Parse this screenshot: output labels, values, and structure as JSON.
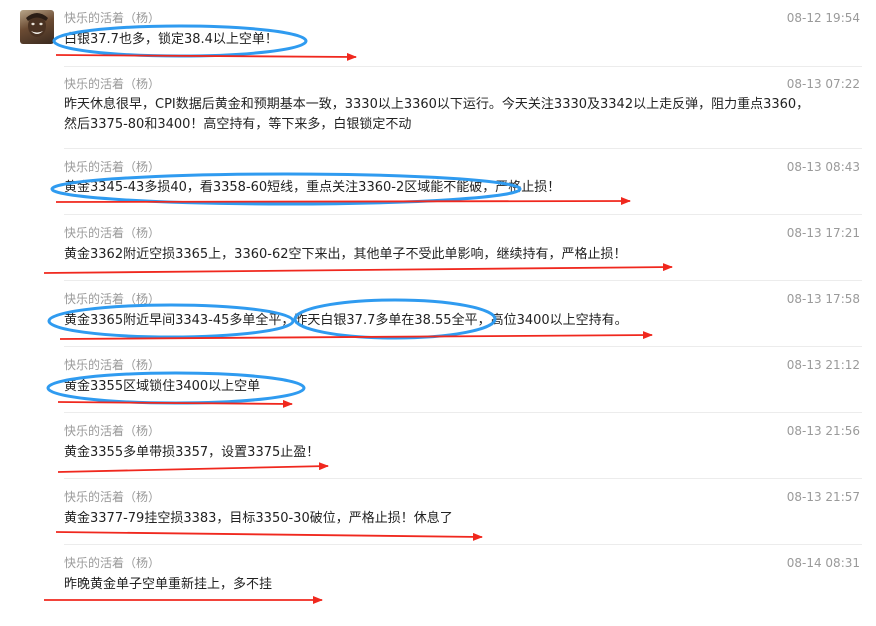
{
  "messages": [
    {
      "author": "快乐的活着（杨）",
      "time": "08-12 19:54",
      "lines": [
        "白银37.7也多，锁定38.4以上空单！"
      ]
    },
    {
      "author": "快乐的活着（杨）",
      "time": "08-13 07:22",
      "lines": [
        "昨天休息很早，CPI数据后黄金和预期基本一致，3330以上3360以下运行。今天关注3330及3342以上走反弹，阻力重点3360，",
        "然后3375-80和3400！高空持有，等下来多，白银锁定不动"
      ]
    },
    {
      "author": "快乐的活着（杨）",
      "time": "08-13 08:43",
      "lines": [
        "黄金3345-43多损40，看3358-60短线，重点关注3360-2区域能不能破，严格止损！"
      ]
    },
    {
      "author": "快乐的活着（杨）",
      "time": "08-13 17:21",
      "lines": [
        "黄金3362附近空损3365上，3360-62空下来出，其他单子不受此单影响，继续持有，严格止损！"
      ]
    },
    {
      "author": "快乐的活着（杨）",
      "time": "08-13 17:58",
      "lines": [
        "黄金3365附近早间3343-45多单全平，昨天白银37.7多单在38.55全平，高位3400以上空持有。"
      ]
    },
    {
      "author": "快乐的活着（杨）",
      "time": "08-13 21:12",
      "lines": [
        "黄金3355区域锁住3400以上空单"
      ]
    },
    {
      "author": "快乐的活着（杨）",
      "time": "08-13 21:56",
      "lines": [
        "黄金3355多单带损3357，设置3375止盈！"
      ]
    },
    {
      "author": "快乐的活着（杨）",
      "time": "08-13 21:57",
      "lines": [
        "黄金3377-79挂空损3383，目标3350-30破位，严格止损！休息了"
      ]
    },
    {
      "author": "快乐的活着（杨）",
      "time": "08-14 08:31",
      "lines": [
        "昨晚黄金单子空单重新挂上，多不挂"
      ]
    }
  ],
  "colors": {
    "annotation_ellipse": "#2f9bf0",
    "annotation_arrow": "#f0281e"
  }
}
